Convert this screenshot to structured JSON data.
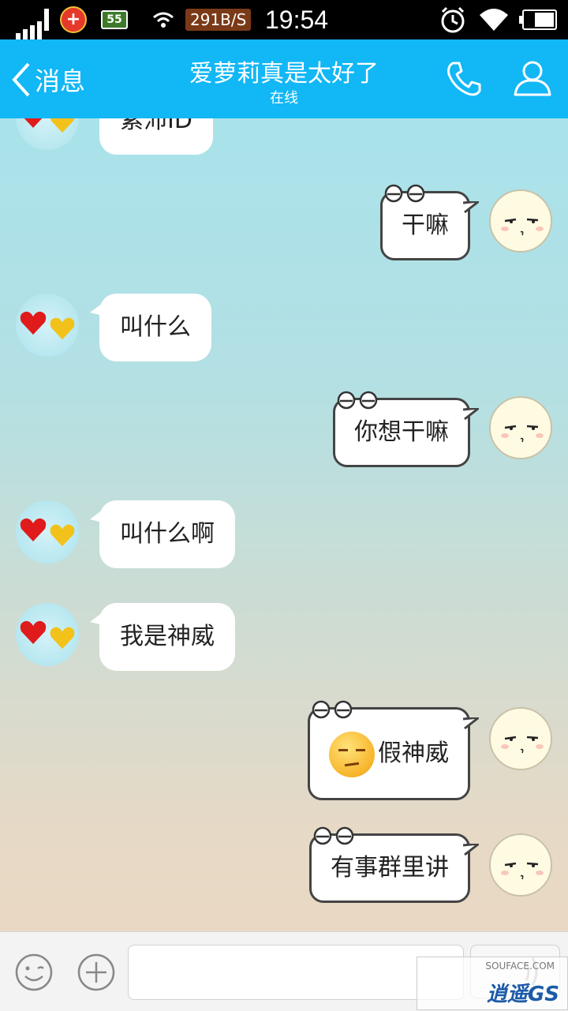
{
  "status_bar": {
    "network_badge": "55",
    "speed": "291B/S",
    "time": "19:54"
  },
  "header": {
    "back_label": "消息",
    "title": "爱萝莉真是太好了",
    "subtitle": "在线"
  },
  "messages": [
    {
      "side": "left",
      "text": "紫沛ID"
    },
    {
      "side": "right",
      "text": "干嘛"
    },
    {
      "side": "left",
      "text": "叫什么"
    },
    {
      "side": "right",
      "text": "你想干嘛"
    },
    {
      "side": "left",
      "text": "叫什么啊"
    },
    {
      "side": "left",
      "text": "我是神威"
    },
    {
      "side": "right",
      "text": "假神威",
      "emoji": "unamused-face-icon"
    },
    {
      "side": "right",
      "text": "有事群里讲"
    }
  ],
  "input": {
    "placeholder": ""
  },
  "colors": {
    "header": "#12b7f5",
    "bubble_left": "#ffffff",
    "bubble_right_border": "#444444"
  }
}
